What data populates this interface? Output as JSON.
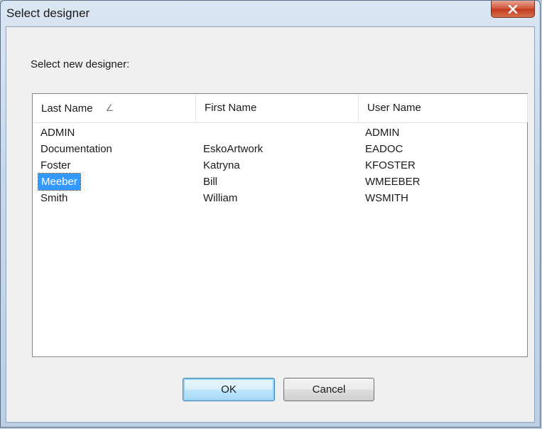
{
  "window": {
    "title": "Select designer",
    "close_icon": "close-icon"
  },
  "dialog": {
    "prompt": "Select new designer:"
  },
  "listview": {
    "columns": [
      {
        "label": "Last Name",
        "sorted": true,
        "sort_icon": "sort-indicator-icon"
      },
      {
        "label": "First Name"
      },
      {
        "label": "User Name"
      }
    ],
    "rows": [
      {
        "last": "ADMIN",
        "first": "",
        "user": "ADMIN",
        "selected": false
      },
      {
        "last": "Documentation",
        "first": "EskoArtwork",
        "user": "EADOC",
        "selected": false
      },
      {
        "last": "Foster",
        "first": "Katryna",
        "user": "KFOSTER",
        "selected": false
      },
      {
        "last": "Meeber",
        "first": "Bill",
        "user": "WMEEBER",
        "selected": true
      },
      {
        "last": "Smith",
        "first": "William",
        "user": "WSMITH",
        "selected": false
      }
    ]
  },
  "buttons": {
    "ok_label": "OK",
    "cancel_label": "Cancel"
  },
  "colors": {
    "selection": "#3399ff",
    "close_button": "#c0391d"
  }
}
